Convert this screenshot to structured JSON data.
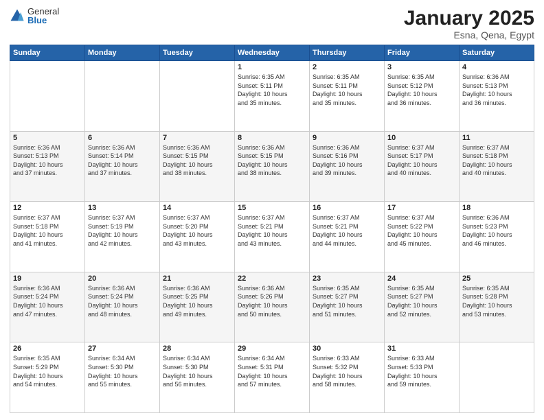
{
  "header": {
    "logo_general": "General",
    "logo_blue": "Blue",
    "title": "January 2025",
    "subtitle": "Esna, Qena, Egypt"
  },
  "weekdays": [
    "Sunday",
    "Monday",
    "Tuesday",
    "Wednesday",
    "Thursday",
    "Friday",
    "Saturday"
  ],
  "weeks": [
    [
      {
        "day": "",
        "info": ""
      },
      {
        "day": "",
        "info": ""
      },
      {
        "day": "",
        "info": ""
      },
      {
        "day": "1",
        "info": "Sunrise: 6:35 AM\nSunset: 5:11 PM\nDaylight: 10 hours\nand 35 minutes."
      },
      {
        "day": "2",
        "info": "Sunrise: 6:35 AM\nSunset: 5:11 PM\nDaylight: 10 hours\nand 35 minutes."
      },
      {
        "day": "3",
        "info": "Sunrise: 6:35 AM\nSunset: 5:12 PM\nDaylight: 10 hours\nand 36 minutes."
      },
      {
        "day": "4",
        "info": "Sunrise: 6:36 AM\nSunset: 5:13 PM\nDaylight: 10 hours\nand 36 minutes."
      }
    ],
    [
      {
        "day": "5",
        "info": "Sunrise: 6:36 AM\nSunset: 5:13 PM\nDaylight: 10 hours\nand 37 minutes."
      },
      {
        "day": "6",
        "info": "Sunrise: 6:36 AM\nSunset: 5:14 PM\nDaylight: 10 hours\nand 37 minutes."
      },
      {
        "day": "7",
        "info": "Sunrise: 6:36 AM\nSunset: 5:15 PM\nDaylight: 10 hours\nand 38 minutes."
      },
      {
        "day": "8",
        "info": "Sunrise: 6:36 AM\nSunset: 5:15 PM\nDaylight: 10 hours\nand 38 minutes."
      },
      {
        "day": "9",
        "info": "Sunrise: 6:36 AM\nSunset: 5:16 PM\nDaylight: 10 hours\nand 39 minutes."
      },
      {
        "day": "10",
        "info": "Sunrise: 6:37 AM\nSunset: 5:17 PM\nDaylight: 10 hours\nand 40 minutes."
      },
      {
        "day": "11",
        "info": "Sunrise: 6:37 AM\nSunset: 5:18 PM\nDaylight: 10 hours\nand 40 minutes."
      }
    ],
    [
      {
        "day": "12",
        "info": "Sunrise: 6:37 AM\nSunset: 5:18 PM\nDaylight: 10 hours\nand 41 minutes."
      },
      {
        "day": "13",
        "info": "Sunrise: 6:37 AM\nSunset: 5:19 PM\nDaylight: 10 hours\nand 42 minutes."
      },
      {
        "day": "14",
        "info": "Sunrise: 6:37 AM\nSunset: 5:20 PM\nDaylight: 10 hours\nand 43 minutes."
      },
      {
        "day": "15",
        "info": "Sunrise: 6:37 AM\nSunset: 5:21 PM\nDaylight: 10 hours\nand 43 minutes."
      },
      {
        "day": "16",
        "info": "Sunrise: 6:37 AM\nSunset: 5:21 PM\nDaylight: 10 hours\nand 44 minutes."
      },
      {
        "day": "17",
        "info": "Sunrise: 6:37 AM\nSunset: 5:22 PM\nDaylight: 10 hours\nand 45 minutes."
      },
      {
        "day": "18",
        "info": "Sunrise: 6:36 AM\nSunset: 5:23 PM\nDaylight: 10 hours\nand 46 minutes."
      }
    ],
    [
      {
        "day": "19",
        "info": "Sunrise: 6:36 AM\nSunset: 5:24 PM\nDaylight: 10 hours\nand 47 minutes."
      },
      {
        "day": "20",
        "info": "Sunrise: 6:36 AM\nSunset: 5:24 PM\nDaylight: 10 hours\nand 48 minutes."
      },
      {
        "day": "21",
        "info": "Sunrise: 6:36 AM\nSunset: 5:25 PM\nDaylight: 10 hours\nand 49 minutes."
      },
      {
        "day": "22",
        "info": "Sunrise: 6:36 AM\nSunset: 5:26 PM\nDaylight: 10 hours\nand 50 minutes."
      },
      {
        "day": "23",
        "info": "Sunrise: 6:35 AM\nSunset: 5:27 PM\nDaylight: 10 hours\nand 51 minutes."
      },
      {
        "day": "24",
        "info": "Sunrise: 6:35 AM\nSunset: 5:27 PM\nDaylight: 10 hours\nand 52 minutes."
      },
      {
        "day": "25",
        "info": "Sunrise: 6:35 AM\nSunset: 5:28 PM\nDaylight: 10 hours\nand 53 minutes."
      }
    ],
    [
      {
        "day": "26",
        "info": "Sunrise: 6:35 AM\nSunset: 5:29 PM\nDaylight: 10 hours\nand 54 minutes."
      },
      {
        "day": "27",
        "info": "Sunrise: 6:34 AM\nSunset: 5:30 PM\nDaylight: 10 hours\nand 55 minutes."
      },
      {
        "day": "28",
        "info": "Sunrise: 6:34 AM\nSunset: 5:30 PM\nDaylight: 10 hours\nand 56 minutes."
      },
      {
        "day": "29",
        "info": "Sunrise: 6:34 AM\nSunset: 5:31 PM\nDaylight: 10 hours\nand 57 minutes."
      },
      {
        "day": "30",
        "info": "Sunrise: 6:33 AM\nSunset: 5:32 PM\nDaylight: 10 hours\nand 58 minutes."
      },
      {
        "day": "31",
        "info": "Sunrise: 6:33 AM\nSunset: 5:33 PM\nDaylight: 10 hours\nand 59 minutes."
      },
      {
        "day": "",
        "info": ""
      }
    ]
  ]
}
